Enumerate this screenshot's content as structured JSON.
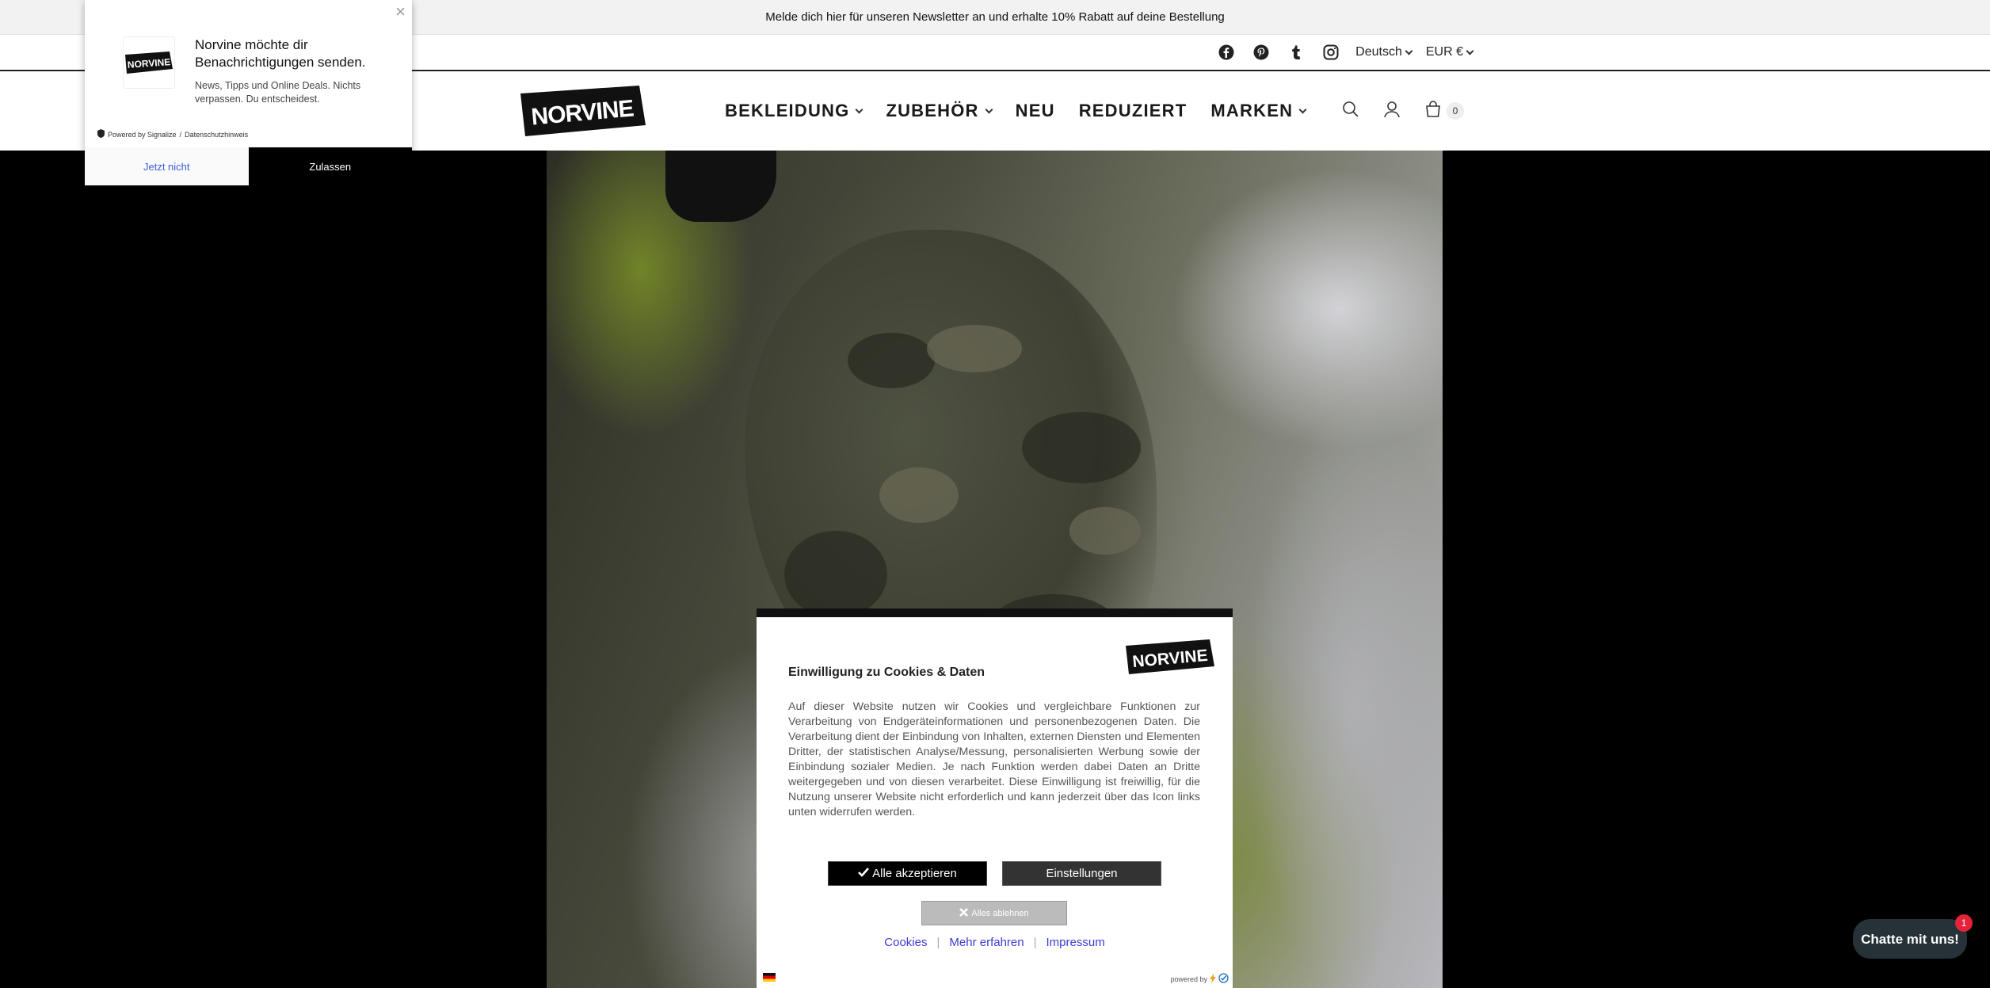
{
  "announcement": {
    "text": "Melde dich hier für unseren Newsletter an und erhalte 10% Rabatt auf deine Bestellung"
  },
  "utility": {
    "social_icons": [
      "facebook-icon",
      "pinterest-icon",
      "tumblr-icon",
      "instagram-icon"
    ],
    "language": "Deutsch",
    "currency": "EUR €"
  },
  "header": {
    "logo_text": "NORVINE",
    "nav": [
      {
        "label": "BEKLEIDUNG",
        "dropdown": true
      },
      {
        "label": "ZUBEHÖR",
        "dropdown": true
      },
      {
        "label": "NEU",
        "dropdown": false
      },
      {
        "label": "REDUZIERT",
        "dropdown": false
      },
      {
        "label": "MARKEN",
        "dropdown": true
      }
    ],
    "cart_count": "0"
  },
  "notification": {
    "title": "Norvine möchte dir Benachrichtigungen senden.",
    "text": "News, Tipps und Online Deals. Nichts verpassen. Du entscheidest.",
    "powered": "Powered by Signalize",
    "separator": "/",
    "privacy": "Datenschutzhinweis",
    "btn_not_now": "Jetzt nicht",
    "btn_allow": "Zulassen"
  },
  "cookie": {
    "title": "Einwilligung zu Cookies & Daten",
    "text": "Auf dieser Website nutzen wir Cookies und vergleichbare Funktionen zur Verarbeitung von Endgeräteinformationen und personenbezogenen Daten. Die Verarbeitung dient der Einbindung von Inhalten, externen Diensten und Elementen Dritter, der statistischen Analyse/Messung, personalisierten Werbung sowie der Einbindung sozialer Medien. Je nach Funktion werden dabei Daten an Dritte weitergegeben und von diesen verarbeitet. Diese Einwilligung ist freiwillig, für die Nutzung unserer Website nicht erforderlich und kann jederzeit über das Icon links unten widerrufen werden.",
    "btn_accept": "Alle akzeptieren",
    "btn_settings": "Einstellungen",
    "btn_reject": "Alles ablehnen",
    "links": [
      "Cookies",
      "Mehr erfahren",
      "Impressum"
    ],
    "link_separator": "|",
    "powered": "powered by"
  },
  "chat": {
    "label": "Chatte mit uns!",
    "badge": "1"
  },
  "colors": {
    "accent_link": "#3b3bd6",
    "chat_bg": "#263238",
    "badge": "#e4233b"
  }
}
